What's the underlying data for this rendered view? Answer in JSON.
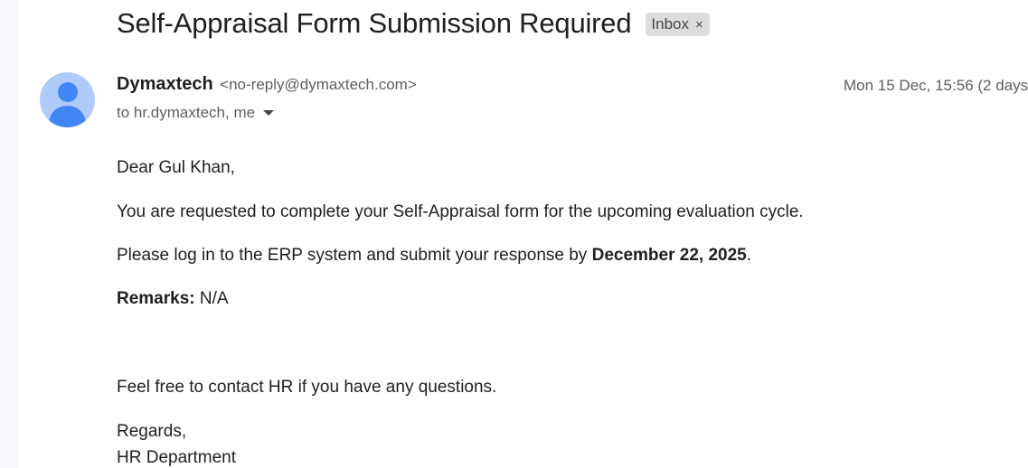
{
  "email": {
    "subject": "Self-Appraisal Form Submission Required",
    "label": "Inbox",
    "label_close": "×",
    "sender_name": "Dymaxtech",
    "sender_email": "<no-reply@dymaxtech.com>",
    "date": "Mon 15 Dec, 15:56 (2 days",
    "recipients": "to hr.dymaxtech, me",
    "body": {
      "greeting": "Dear Gul Khan,",
      "request": "You are requested to complete your Self-Appraisal form for the upcoming evaluation cycle.",
      "deadline_prefix": "Please log in to the ERP system and submit your response by ",
      "deadline_date": "December 22, 2025",
      "deadline_suffix": ".",
      "remarks_label": "Remarks:",
      "remarks_value": " N/A",
      "contact": "Feel free to contact HR if you have any questions.",
      "closing": "Regards,",
      "signature": "HR Department"
    }
  },
  "colors": {
    "avatar_bg": "#aecbfa",
    "avatar_fg": "#4285f4",
    "label_chip_bg": "#dddddd"
  },
  "icons": {
    "avatar": "person-icon",
    "recipients_toggle": "caret-down-icon",
    "label_remove": "close-icon"
  }
}
